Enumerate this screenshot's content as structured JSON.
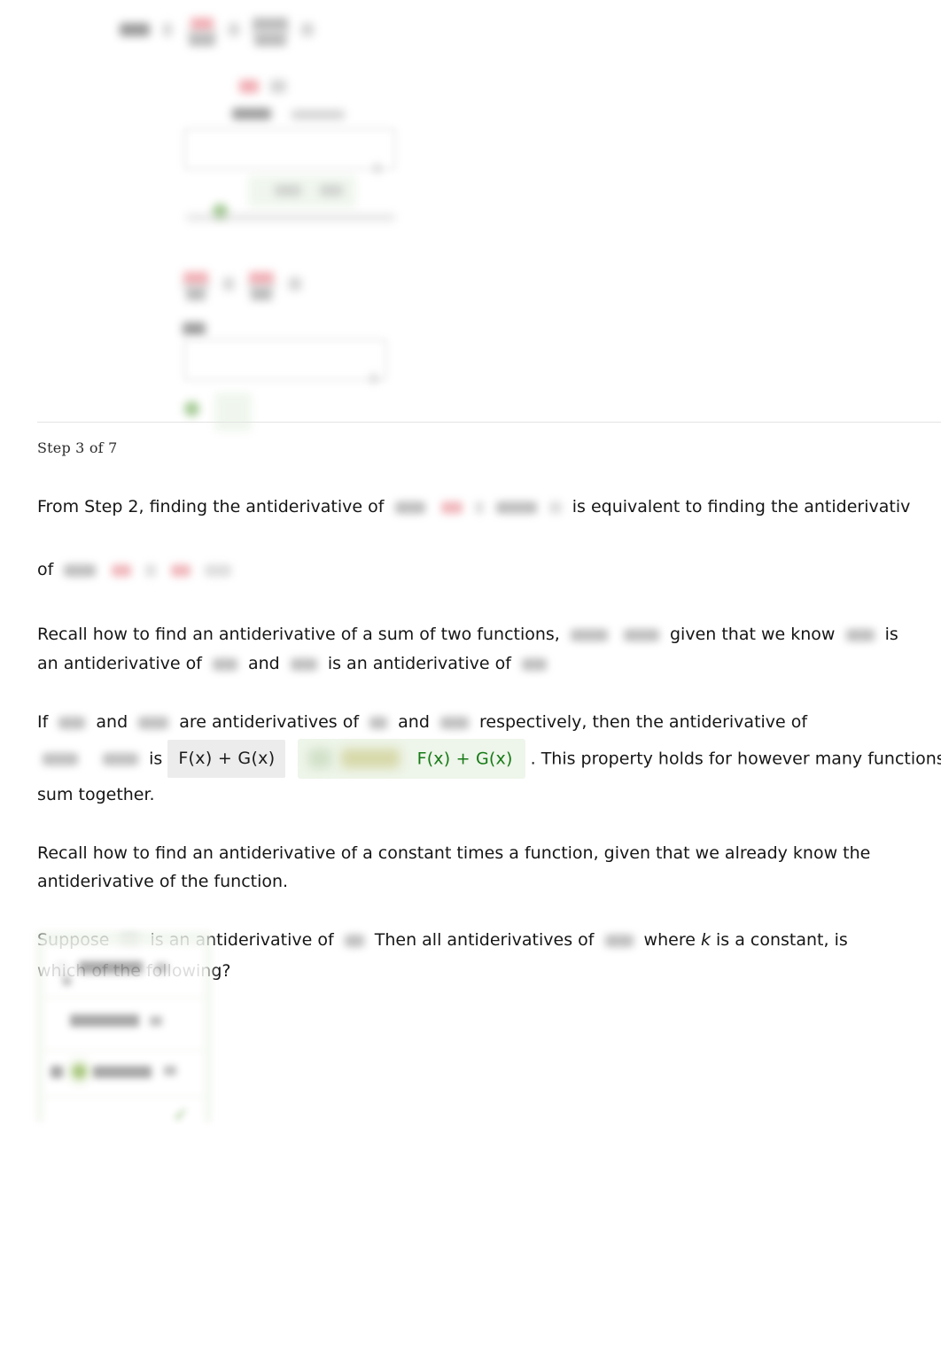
{
  "page": {
    "step_label": "Step 3 of 7",
    "background": "#ffffff",
    "divider_color": "#e3e3e3"
  },
  "colors": {
    "correct_green_text": "#157a15",
    "correct_green_bg": "#eef5ea",
    "answer_chip_bg": "#ececec",
    "choices_panel_bg": "#f2f7ef",
    "choices_panel_border": "#e0ebdb",
    "selected_radio": "#9dbf6e",
    "check_mark": "#5f9b3e",
    "body_text": "#161616"
  },
  "paragraphs": {
    "from_step_2": {
      "lead": "From Step 2, finding the antiderivative of",
      "middle": "is equivalent to finding the antiderivativ",
      "of_label": "of"
    },
    "recall_sum": {
      "part_1": "Recall how to find an antiderivative of a sum of two functions,",
      "part_2": "given that we know",
      "part_3": "is",
      "part_4": "an antiderivative of",
      "part_5": "and",
      "part_6": "is an antiderivative of"
    },
    "if_property": {
      "part_1": "If",
      "part_2": "and",
      "part_3": "are antiderivatives of",
      "part_4": "and",
      "part_5": "respectively, then the antiderivative of",
      "part_6": "is",
      "typed_answer": "F(x) + G(x)",
      "correct_answer": "F(x) + G(x)",
      "part_7": ". This property holds for however many functions we",
      "part_8": "sum together."
    },
    "recall_constant": {
      "line_1": "Recall how to find an antiderivative of a constant times a function, given that we already know the",
      "line_2": "antiderivative of the function."
    },
    "suppose_question": {
      "part_1": "Suppose",
      "part_2": "is an antiderivative of",
      "part_3": "Then all antiderivatives of",
      "part_4": "where",
      "italic_var": "k",
      "part_5": "is a constant, is",
      "line_2": "which of the following?"
    }
  },
  "choices": {
    "count": 3,
    "selected_index": 2,
    "check_glyph": "✓",
    "options": [
      {
        "label": "",
        "selected": false
      },
      {
        "label": "",
        "selected": false
      },
      {
        "label": "",
        "selected": true
      }
    ]
  },
  "top_region": {
    "note": "scrolled-off prior steps: blurred equations, two answer-entry cards with input boxes and green correct-feedback bands",
    "cards": 2
  }
}
